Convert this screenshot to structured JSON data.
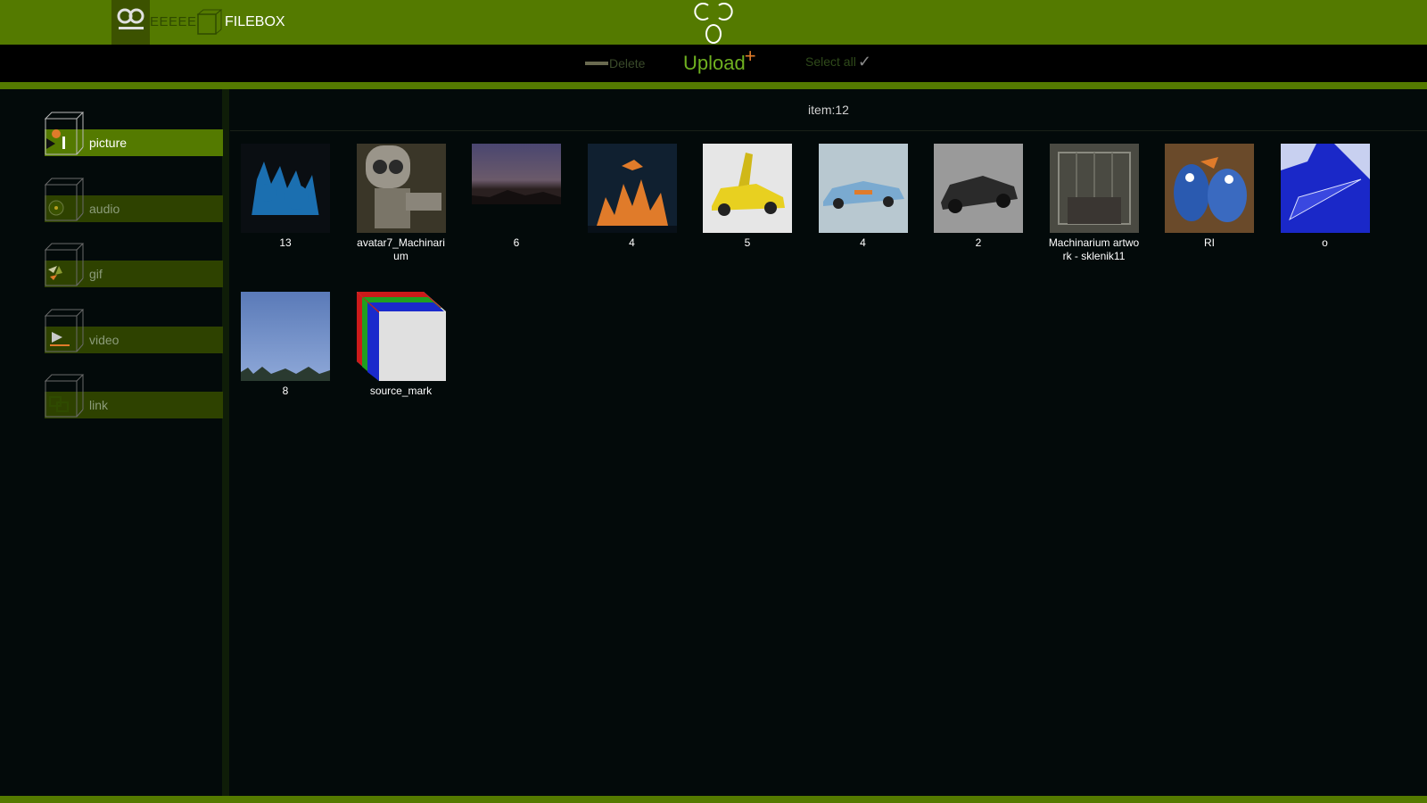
{
  "header": {
    "username": "EEEEE",
    "brand": "FILEBOX"
  },
  "toolbar": {
    "delete_label": "Delete",
    "upload_label": "Upload",
    "select_all_label": "Select all"
  },
  "sidebar": {
    "items": [
      {
        "label": "picture",
        "active": true
      },
      {
        "label": "audio",
        "active": false
      },
      {
        "label": "gif",
        "active": false
      },
      {
        "label": "video",
        "active": false
      },
      {
        "label": "link",
        "active": false
      }
    ]
  },
  "main": {
    "item_count": "item:12",
    "files": [
      {
        "name": "13"
      },
      {
        "name": "avatar7_Machinarium"
      },
      {
        "name": "6"
      },
      {
        "name": "4"
      },
      {
        "name": "5"
      },
      {
        "name": "4"
      },
      {
        "name": "2"
      },
      {
        "name": "Machinarium artwork - sklenik11"
      },
      {
        "name": "RI"
      },
      {
        "name": "o"
      },
      {
        "name": "8"
      },
      {
        "name": "source_mark"
      }
    ]
  },
  "colors": {
    "header_green": "#547a00",
    "sidebar_active": "#547a00",
    "sidebar_inactive": "#2e4200",
    "upload_accent": "#6fb020",
    "plus_orange": "#e07b2a",
    "background": "#030a0a"
  }
}
